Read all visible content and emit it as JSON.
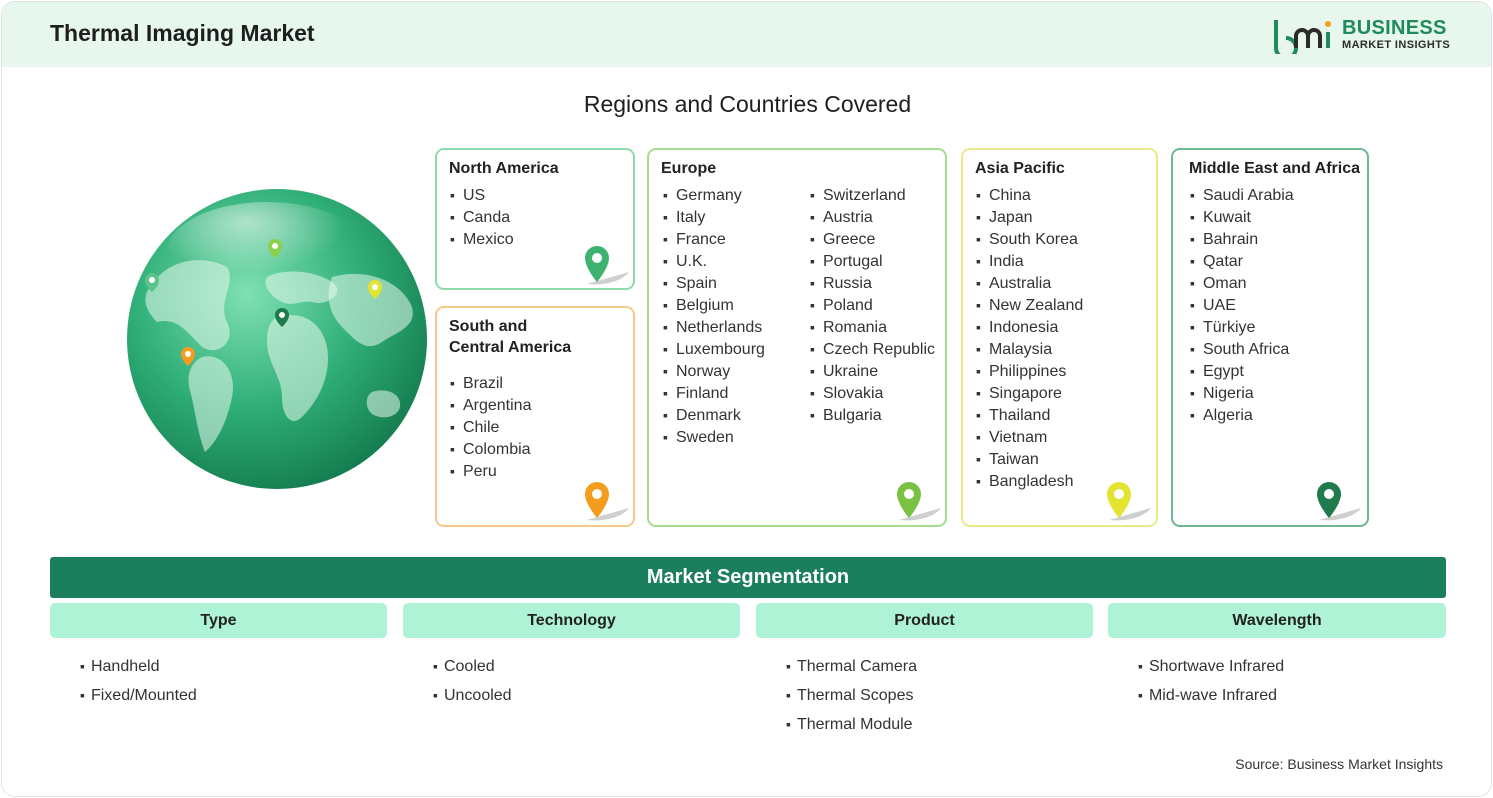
{
  "header": {
    "title": "Thermal Imaging Market",
    "logo_line1": "BUSINESS",
    "logo_line2": "MARKET INSIGHTS"
  },
  "section_title": "Regions and Countries Covered",
  "colors": {
    "header_bg": "#e7f7ee",
    "brand_green": "#1b7e5d",
    "segment_head_bg": "#aef3d6"
  },
  "regions": {
    "north_america": {
      "title": "North America",
      "countries": [
        "US",
        "Canda",
        "Mexico"
      ],
      "border": "#8fd9ac",
      "pin": "#3db36f"
    },
    "south_central_america": {
      "title": "South and Central America",
      "title_line1": "South and",
      "title_line2": "Central America",
      "countries": [
        "Brazil",
        "Argentina",
        "Chile",
        "Colombia",
        "Peru"
      ],
      "border": "#f5c98a",
      "pin": "#f39c1e"
    },
    "europe": {
      "title": "Europe",
      "countries_col1": [
        "Germany",
        "Italy",
        "France",
        "U.K.",
        "Spain",
        "Belgium",
        "Netherlands",
        "Luxembourg",
        "Norway",
        "Finland",
        "Denmark",
        "Sweden"
      ],
      "countries_col2": [
        "Switzerland",
        "Austria",
        "Greece",
        "Portugal",
        "Russia",
        "Poland",
        "Romania",
        "Czech Republic",
        "Ukraine",
        "Slovakia",
        "Bulgaria"
      ],
      "border": "#a7dd8f",
      "pin": "#7cc242"
    },
    "asia_pacific": {
      "title": "Asia Pacific",
      "countries": [
        "China",
        "Japan",
        "South Korea",
        "India",
        "Australia",
        "New Zealand",
        "Indonesia",
        "Malaysia",
        "Philippines",
        "Singapore",
        "Thailand",
        "Vietnam",
        "Taiwan",
        "Bangladesh"
      ],
      "border": "#eaea8a",
      "pin": "#e3e332"
    },
    "middle_east_africa": {
      "title": "Middle East and Africa",
      "countries": [
        "Saudi Arabia",
        "Kuwait",
        "Bahrain",
        "Qatar",
        "Oman",
        "UAE",
        "Türkiye",
        "South Africa",
        "Egypt",
        "Nigeria",
        "Algeria"
      ],
      "border": "#6fb78f",
      "pin": "#1f7a4c"
    }
  },
  "segmentation": {
    "title": "Market Segmentation",
    "columns": [
      {
        "header": "Type",
        "items": [
          "Handheld",
          "Fixed/Mounted"
        ]
      },
      {
        "header": "Technology",
        "items": [
          "Cooled",
          "Uncooled"
        ]
      },
      {
        "header": "Product",
        "items": [
          "Thermal Camera",
          "Thermal Scopes",
          "Thermal Module"
        ]
      },
      {
        "header": "Wavelength",
        "items": [
          "Shortwave Infrared",
          "Mid-wave Infrared"
        ]
      }
    ]
  },
  "source": "Source: Business Market Insights"
}
